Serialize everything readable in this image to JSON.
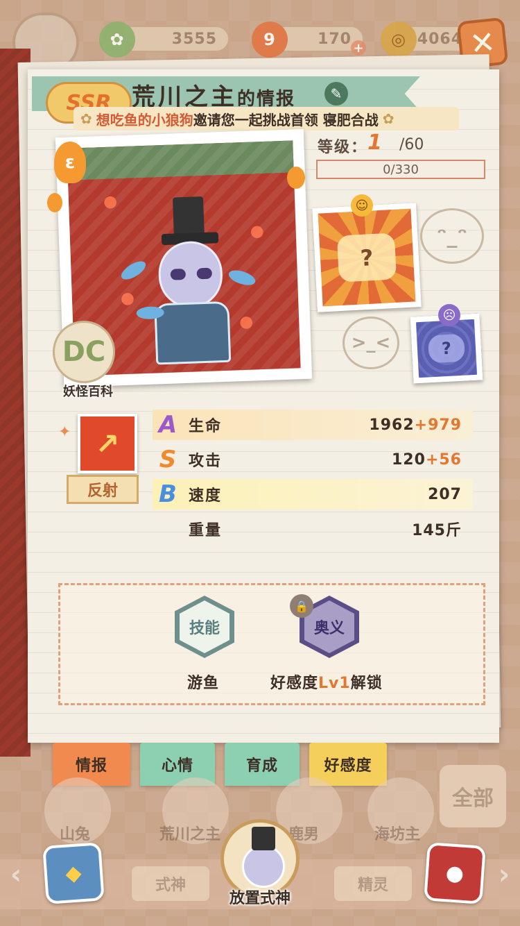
{
  "currency": {
    "jade": "3555",
    "stamina": "170",
    "coins": "4064"
  },
  "close_label": "✕",
  "hero": {
    "rarity": "SSR",
    "name": "荒川之主",
    "name_suffix": "的情报"
  },
  "invite": {
    "player": "想吃鱼的小狼狗",
    "text": "邀请您一起挑战首领 寝肥合战"
  },
  "level": {
    "label": "等级：",
    "value": "1",
    "max": "/60",
    "exp_text": "0/330",
    "exp_progress": 0
  },
  "encyclopedia_label": "妖怪百科",
  "skill": {
    "tag": "反射"
  },
  "stats": [
    {
      "grade": "A",
      "grade_color": "#9b5ac9",
      "name": "生命",
      "base": "1962",
      "bonus": "+979"
    },
    {
      "grade": "S",
      "grade_color": "#f08a2c",
      "name": "攻击",
      "base": "120",
      "bonus": "+56"
    },
    {
      "grade": "B",
      "grade_color": "#4a8ee0",
      "name": "速度",
      "base": "207",
      "bonus": ""
    },
    {
      "grade": "",
      "grade_color": "#3e2f26",
      "name": "重量",
      "base": "145斤",
      "bonus": ""
    }
  ],
  "abilities": {
    "skill_hex": "技能",
    "skill_label": "游鱼",
    "ougi_hex": "奥义",
    "ougi_label_pre": "好感度",
    "ougi_label_lv": "Lv1",
    "ougi_label_post": "解锁"
  },
  "tabs": [
    "情报",
    "心情",
    "育成",
    "好感度"
  ],
  "roster": {
    "names": [
      "山兔",
      "荒川之主",
      "鹿男",
      "海坊主"
    ],
    "all_button": "全部",
    "bottom_tabs": [
      "式神",
      "精灵"
    ],
    "center_label": "放置式神"
  },
  "colors": {
    "accent": "#f08a4e",
    "bonus": "#e5762f",
    "banner": "#9bc5b0"
  }
}
